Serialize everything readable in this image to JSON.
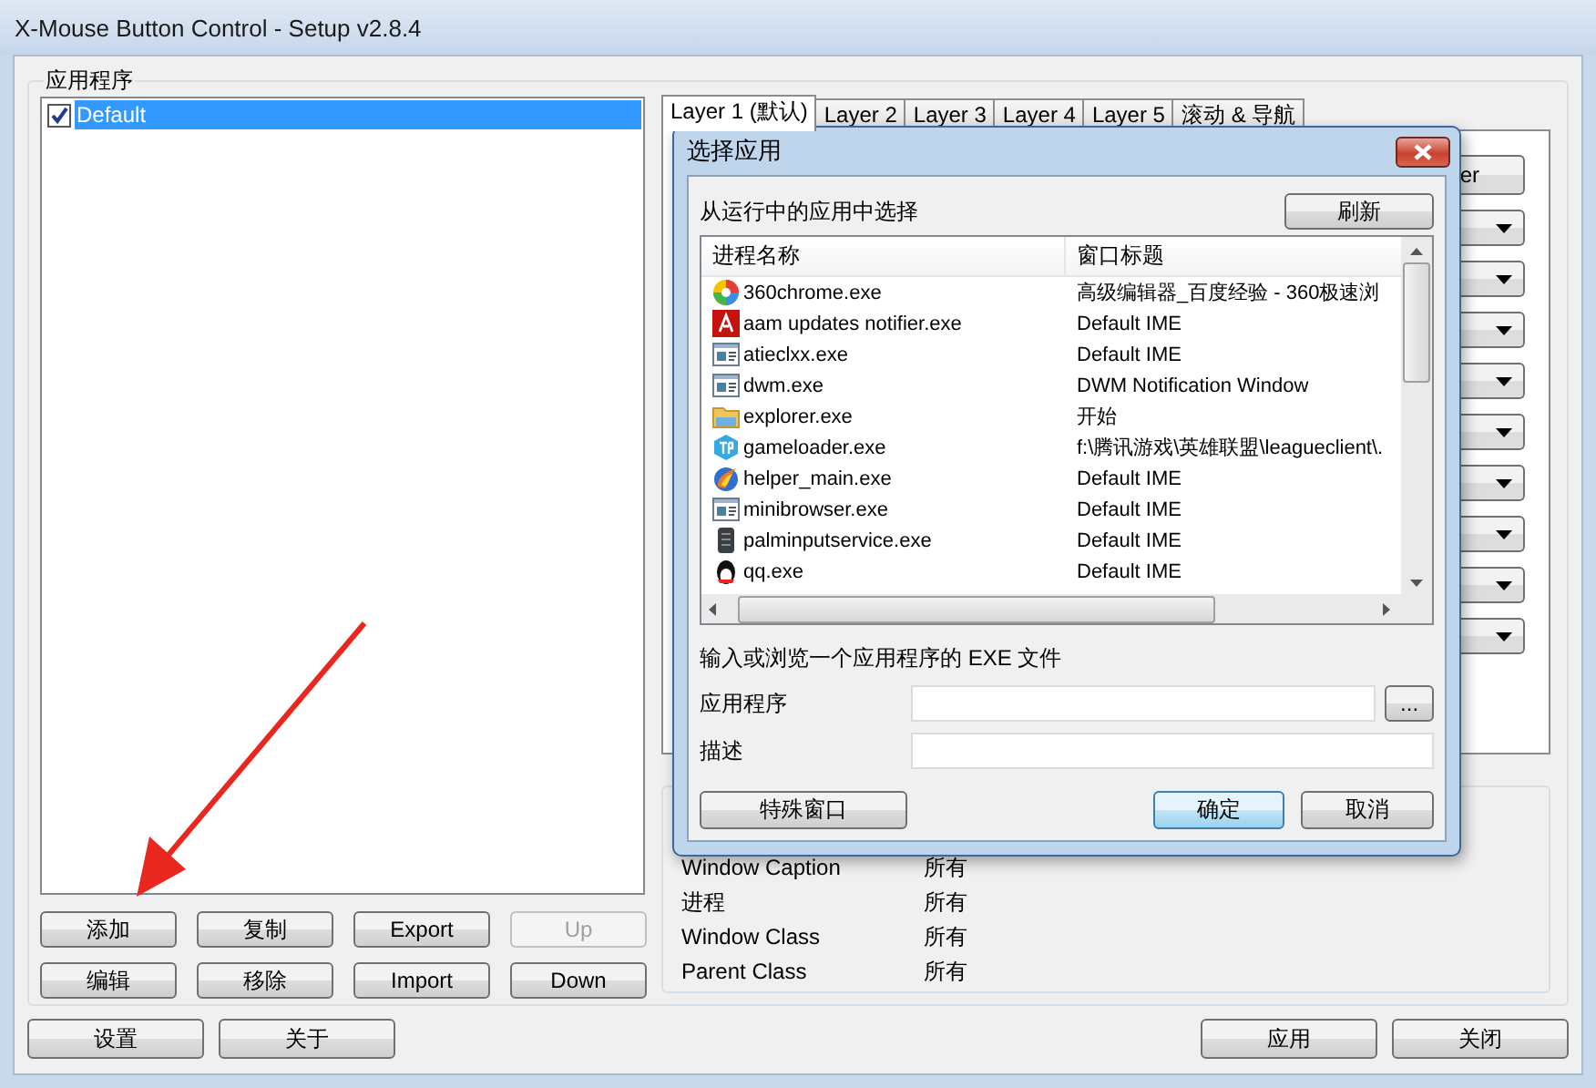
{
  "window": {
    "title": "X-Mouse Button Control - Setup v2.8.4"
  },
  "applications": {
    "legend": "应用程序",
    "items": [
      {
        "label": "Default",
        "checked": true,
        "selected": true
      }
    ],
    "buttons": [
      {
        "label": "添加",
        "disabled": false
      },
      {
        "label": "复制",
        "disabled": false
      },
      {
        "label": "Export",
        "disabled": false
      },
      {
        "label": "Up",
        "disabled": true
      },
      {
        "label": "编辑",
        "disabled": false
      },
      {
        "label": "移除",
        "disabled": false
      },
      {
        "label": "Import",
        "disabled": false
      },
      {
        "label": "Down",
        "disabled": false
      }
    ]
  },
  "tabs": [
    {
      "label": "Layer 1 (默认)",
      "selected": true
    },
    {
      "label": "Layer 2",
      "selected": false
    },
    {
      "label": "Layer 3",
      "selected": false
    },
    {
      "label": "Layer 4",
      "selected": false
    },
    {
      "label": "Layer 5",
      "selected": false
    },
    {
      "label": "滚动 & 导航",
      "selected": false
    }
  ],
  "layer_panel": {
    "button_label": "er"
  },
  "filter": {
    "rows": [
      {
        "label": "Window Caption",
        "value": "所有"
      },
      {
        "label": "进程",
        "value": "所有"
      },
      {
        "label": "Window Class",
        "value": "所有"
      },
      {
        "label": "Parent Class",
        "value": "所有"
      }
    ]
  },
  "footer": {
    "left": [
      "设置",
      "关于"
    ],
    "right": [
      "应用",
      "关闭"
    ]
  },
  "dialog": {
    "title": "选择应用",
    "running_label": "从运行中的应用中选择",
    "refresh": "刷新",
    "columns": [
      "进程名称",
      "窗口标题"
    ],
    "rows": [
      {
        "kind": "ball",
        "process": "360chrome.exe",
        "caption": "高级编辑器_百度经验 - 360极速浏"
      },
      {
        "kind": "adobe",
        "process": "aam updates notifier.exe",
        "caption": "Default IME"
      },
      {
        "kind": "window",
        "process": "atieclxx.exe",
        "caption": "Default IME"
      },
      {
        "kind": "window",
        "process": "dwm.exe",
        "caption": "DWM Notification Window"
      },
      {
        "kind": "folder",
        "process": "explorer.exe",
        "caption": "开始"
      },
      {
        "kind": "badge",
        "process": "gameloader.exe",
        "caption": "f:\\腾讯游戏\\英雄联盟\\leagueclient\\."
      },
      {
        "kind": "flame",
        "process": "helper_main.exe",
        "caption": "Default IME"
      },
      {
        "kind": "window",
        "process": "minibrowser.exe",
        "caption": "Default IME"
      },
      {
        "kind": "device",
        "process": "palminputservice.exe",
        "caption": "Default IME"
      },
      {
        "kind": "bird",
        "process": "qq.exe",
        "caption": "Default IME"
      }
    ],
    "browse_label": "输入或浏览一个应用程序的 EXE 文件",
    "app_label": "应用程序",
    "browse_button": "...",
    "desc_label": "描述",
    "buttons": [
      {
        "label": "特殊窗口",
        "default": false
      },
      {
        "label": "确定",
        "default": true
      },
      {
        "label": "取消",
        "default": false
      }
    ]
  }
}
